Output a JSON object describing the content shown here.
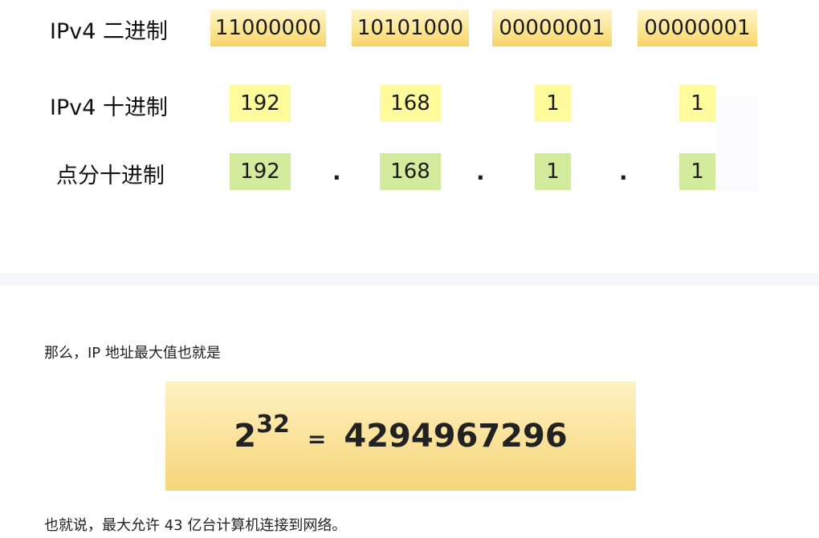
{
  "diagram": {
    "rows": [
      {
        "label": "IPv4 二进制",
        "cells": [
          "11000000",
          "10101000",
          "00000001",
          "00000001"
        ]
      },
      {
        "label": "IPv4 十进制",
        "cells": [
          "192",
          "168",
          "1",
          "1"
        ]
      },
      {
        "label": "点分十进制",
        "cells": [
          "192",
          "168",
          "1",
          "1"
        ],
        "separators": [
          ".",
          ".",
          "."
        ]
      }
    ],
    "colors": {
      "binary": "#fbe48f",
      "decimal": "#fdfb9b",
      "dotted": "#d2eb9c"
    }
  },
  "text": {
    "intro": "那么，IP 地址最大值也就是",
    "conclusion": "也就说，最大允许 43 亿台计算机连接到网络。"
  },
  "formula": {
    "base": "2",
    "exponent": "32",
    "equals": "=",
    "result": "4294967296"
  }
}
